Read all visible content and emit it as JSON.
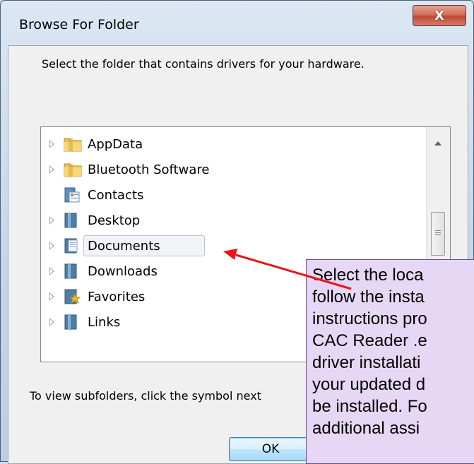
{
  "window": {
    "title": "Browse For Folder",
    "close_glyph": "X"
  },
  "dialog": {
    "prompt": "Select the folder that contains drivers for your hardware.",
    "hint": "To view subfolders, click the symbol next",
    "ok_label": "OK"
  },
  "tree": {
    "items": [
      {
        "label": "AppData",
        "icon": "folder-icon",
        "expandable": true
      },
      {
        "label": "Bluetooth Software",
        "icon": "folder-icon",
        "expandable": true
      },
      {
        "label": "Contacts",
        "icon": "contacts-icon",
        "expandable": false
      },
      {
        "label": "Desktop",
        "icon": "desktop-folder-icon",
        "expandable": true
      },
      {
        "label": "Documents",
        "icon": "documents-folder-icon",
        "expandable": true,
        "selected": true
      },
      {
        "label": "Downloads",
        "icon": "downloads-folder-icon",
        "expandable": true
      },
      {
        "label": "Favorites",
        "icon": "favorites-folder-icon",
        "expandable": true
      },
      {
        "label": "Links",
        "icon": "links-folder-icon",
        "expandable": true
      }
    ]
  },
  "callout": {
    "lines": [
      "Select the loca",
      "follow the insta",
      "instructions pro",
      "CAC Reader .e",
      "driver installati",
      "your updated d",
      "be installed. Fo",
      "additional assi"
    ]
  },
  "colors": {
    "callout_bg": "#e6d8f4",
    "arrow": "#e8161b",
    "close_button": "#c24832"
  }
}
